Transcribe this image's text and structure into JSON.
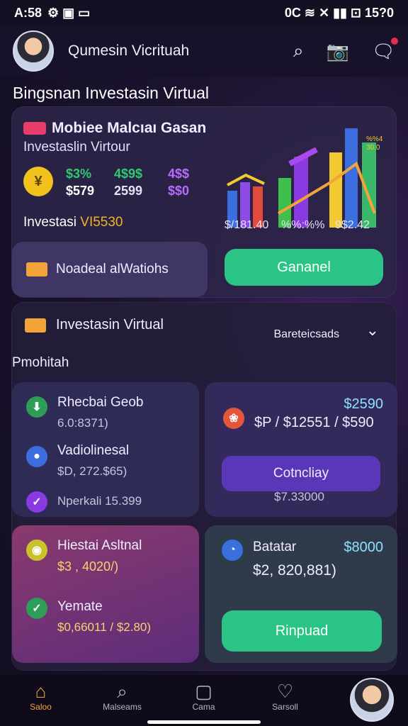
{
  "status": {
    "time": "A:58",
    "left_icons": "⚙ ▣ ▭",
    "right": "0C ≋ ✕ ▮▮ ⊡ 15?0"
  },
  "header": {
    "title": "Qumesin Vicrituah"
  },
  "section_title": "Bingsnan Investasin Virtual",
  "hero": {
    "tag": "Mobiee Malcıaı Gasan",
    "subtitle": "Investaslin Virtour",
    "stats": [
      {
        "top": "$3%",
        "bottom": "$579",
        "color": "#2ecc71"
      },
      {
        "top": "4$9$",
        "bottom": "2599",
        "color": "#e6e1f5"
      },
      {
        "top": "4$$",
        "bottom": "$$0",
        "color": "#b86bff"
      }
    ],
    "invest_label": "Investasi",
    "invest_value": "VI5530",
    "chart_ticks": [
      "$/181.40",
      "%%:%%",
      "9$2.42"
    ],
    "chart_note": "%%4\n30.0",
    "notif_label": "Noadeal alWatiohs",
    "cta": "Gananel"
  },
  "panel": {
    "title": "Investasin Virtual",
    "filter": "Bareteicsads",
    "subtitle": "Pmohitah",
    "m1": {
      "r1_title": "Rhecbai Geob",
      "r1_value": "6.0:8371)",
      "r2_title": "Vadiolinesal",
      "r2_value": "$D, 272.$65)",
      "r3_title": "Nperkali 15.399"
    },
    "m2": {
      "amount_top": "$2590",
      "amount_mid": "$P / $12551 / $590",
      "btn": "Cotncliay",
      "sub": "$7.33000"
    },
    "m3": {
      "r1_title": "Hiestai Asltnal",
      "r1_value": "$3 , 4020/)",
      "r2_title": "Yemate",
      "r2_value": "$0,66011 / $2.80)"
    },
    "m4": {
      "title": "Batatar",
      "amount": "$8000",
      "value": "$2, 820,881)",
      "btn": "Rinpuad"
    }
  },
  "nav": [
    {
      "label": "Saloo",
      "icon": "⌂"
    },
    {
      "label": "Malseams",
      "icon": "⌕"
    },
    {
      "label": "Cama",
      "icon": "▢"
    },
    {
      "label": "Sarsoll",
      "icon": "♡"
    }
  ],
  "colors": {
    "accent": "#2bc487",
    "purple": "#5a36b8",
    "warning": "#f2a43a"
  }
}
